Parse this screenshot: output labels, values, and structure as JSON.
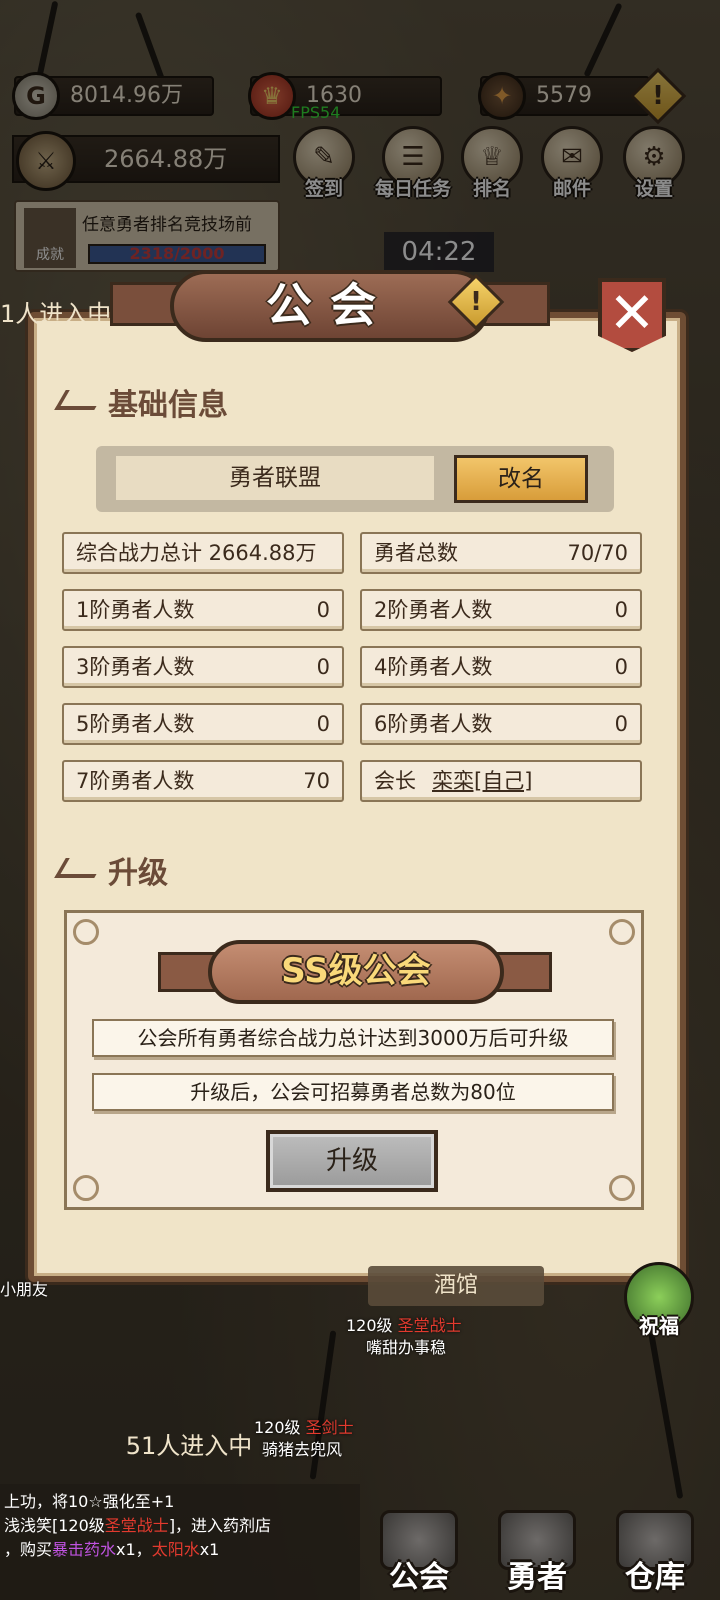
{
  "hud": {
    "gold": "8014.96万",
    "honor": "1630",
    "gems": "5579",
    "fps": "FPS54",
    "total_power": "2664.88万",
    "timer": "04:22",
    "warning": "!"
  },
  "top_buttons": [
    {
      "label": "签到",
      "icon": "quill-icon"
    },
    {
      "label": "每日任务",
      "icon": "scroll-icon"
    },
    {
      "label": "排名",
      "icon": "trophy-icon"
    },
    {
      "label": "邮件",
      "icon": "mail-icon"
    },
    {
      "label": "设置",
      "icon": "gear-icon"
    }
  ],
  "achievement": {
    "badge": "成就",
    "text": "任意勇者排名竞技场前",
    "progress_text": "2318/2000"
  },
  "guild": {
    "title": "公会",
    "close": "✕",
    "basic_section": "基础信息",
    "name": "勇者联盟",
    "rename_label": "改名",
    "stats": [
      {
        "label": "综合战力总计 2664.88万",
        "value": ""
      },
      {
        "label": "勇者总数",
        "value": "70/70"
      },
      {
        "label": "1阶勇者人数",
        "value": "0"
      },
      {
        "label": "2阶勇者人数",
        "value": "0"
      },
      {
        "label": "3阶勇者人数",
        "value": "0"
      },
      {
        "label": "4阶勇者人数",
        "value": "0"
      },
      {
        "label": "5阶勇者人数",
        "value": "0"
      },
      {
        "label": "6阶勇者人数",
        "value": "0"
      },
      {
        "label": "7阶勇者人数",
        "value": "70"
      }
    ],
    "leader_label": "会长",
    "leader_name": "栾栾[自己]",
    "upgrade_section": "升级",
    "tier_title": "SS级公会",
    "requirement_1": "公会所有勇者综合战力总计达到3000万后可升级",
    "requirement_2": "升级后，公会可招募勇者总数为80位",
    "upgrade_button": "升级"
  },
  "scene": {
    "tavern": "酒馆",
    "bless": "祝福",
    "npc1_level": "120级",
    "npc1_class": "圣堂战士",
    "npc1_name": "嘴甜办事稳",
    "npc2_level": "120级",
    "npc2_class": "圣剑士",
    "npc2_name": "骑猪去兜风",
    "queue": "51人进入中",
    "left_edge_1": "1人进入中",
    "left_edge_2": "小朋友"
  },
  "chat": {
    "line1": "上功，将10☆",
    "line1_tail": "强化至+1",
    "line2_user": "浅浅笑[120级",
    "line2_class": "圣堂战士",
    "line2_tail": "]，进入药剂店",
    "line3_pre": "，购买",
    "line3_item1": "暴击药水",
    "line3_mid": "x1，",
    "line3_item2": "太阳水",
    "line3_tail": "x1"
  },
  "bottom_nav": [
    {
      "label": "公会"
    },
    {
      "label": "勇者"
    },
    {
      "label": "仓库"
    }
  ],
  "colors": {
    "panel_bg": "#f0e4c8",
    "panel_border": "#6e4d34",
    "accent_gold": "#f2c56a",
    "danger_red": "#b34c3f",
    "fps_green": "#37e03a"
  }
}
